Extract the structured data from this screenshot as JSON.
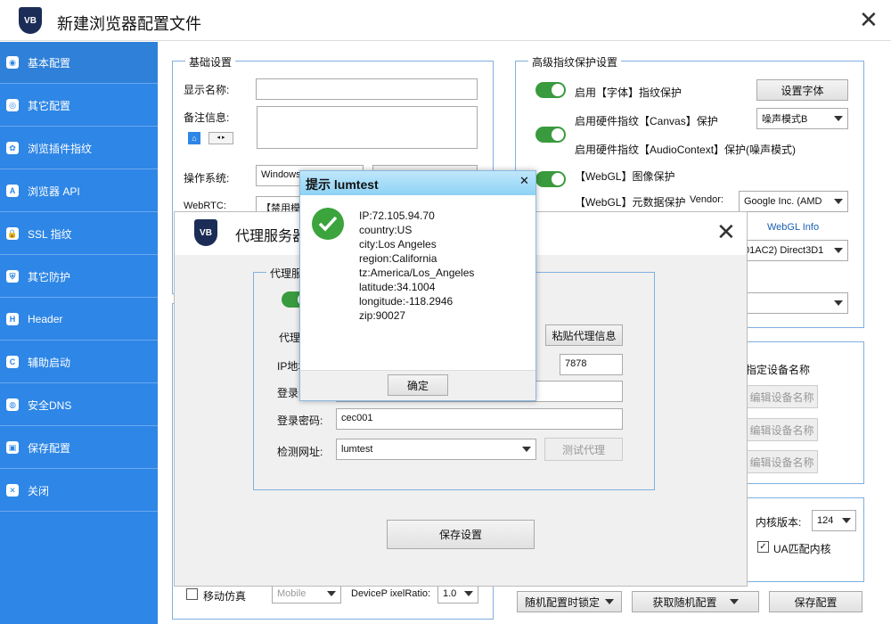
{
  "window": {
    "title": "新建浏览器配置文件",
    "logo_text": "VB",
    "close": "✕"
  },
  "sidebar": {
    "items": [
      {
        "label": "基本配置",
        "icon": "compass-icon",
        "glyph": "◉"
      },
      {
        "label": "其它配置",
        "icon": "chrome-icon",
        "glyph": "◎"
      },
      {
        "label": "浏览插件指纹",
        "icon": "plugin-icon",
        "glyph": "✿"
      },
      {
        "label": "浏览器 API",
        "icon": "api-icon",
        "glyph": "A"
      },
      {
        "label": "SSL 指纹",
        "icon": "lock-icon",
        "glyph": "🔒"
      },
      {
        "label": "其它防护",
        "icon": "shield-icon",
        "glyph": "⛨"
      },
      {
        "label": "Header",
        "icon": "header-icon",
        "glyph": "H"
      },
      {
        "label": "辅助启动",
        "icon": "cmd-icon",
        "glyph": "C"
      },
      {
        "label": "安全DNS",
        "icon": "globe-icon",
        "glyph": "◍"
      },
      {
        "label": "保存配置",
        "icon": "save-icon",
        "glyph": "▣"
      },
      {
        "label": "关闭",
        "icon": "close-circle-icon",
        "glyph": "✕"
      }
    ]
  },
  "basic": {
    "title": "基础设置",
    "display_name_label": "显示名称:",
    "display_name_value": "",
    "note_label": "备注信息:",
    "os_label": "操作系统:",
    "os_value": "Windows",
    "webrtc_label": "WebRTC:",
    "webrtc_value": "【禁用模"
  },
  "advanced": {
    "title": "高级指纹保护设置",
    "font_toggle": "启用【字体】指纹保护",
    "font_button": "设置字体",
    "canvas_toggle": "启用硬件指纹【Canvas】保护",
    "canvas_mode": "噪声模式B",
    "audio_toggle": "启用硬件指纹【AudioContext】保护(噪声模式)",
    "webgl_image_toggle": "【WebGL】图像保护",
    "webgl_meta_toggle": "【WebGL】元数据保护",
    "vendor_label": "Vendor:",
    "vendor_value": "Google Inc. (AMD",
    "webgl_info": "WebGL Info",
    "renderer_value": "01AC2) Direct3D1"
  },
  "device": {
    "title": "指定设备名称",
    "btn1": "编辑设备名称",
    "btn2": "编辑设备名称",
    "btn3": "编辑设备名称"
  },
  "kernel": {
    "label": "内核版本:",
    "value": "124",
    "ua_match": "UA匹配内核"
  },
  "bottom": {
    "mobile_label": "移动仿真",
    "mobile_value": "Mobile",
    "dpr_label": "DeviceP ixelRatio:",
    "dpr_value": "1.0",
    "random_lock": "随机配置时锁定",
    "get_random": "获取随机配置",
    "save_config": "保存配置"
  },
  "proxy": {
    "title": "代理服务器",
    "group_title": "代理服",
    "type_label": "代理",
    "paste_button": "粘贴代理信息",
    "ip_label": "IP地址",
    "port_value": "7878",
    "login_user_label": "登录",
    "password_label": "登录密码:",
    "password_value": "cec001",
    "check_url_label": "检测网址:",
    "check_url_value": "lumtest",
    "test_button": "测试代理",
    "save_button": "保存设置"
  },
  "alert": {
    "title": "提示 lumtest",
    "close": "✕",
    "lines": [
      "IP:72.105.94.70",
      "country:US",
      "city:Los Angeles",
      "region:California",
      "tz:America/Los_Angeles",
      "latitude:34.1004",
      "longitude:-118.2946",
      "zip:90027"
    ],
    "ok_button": "确定"
  }
}
